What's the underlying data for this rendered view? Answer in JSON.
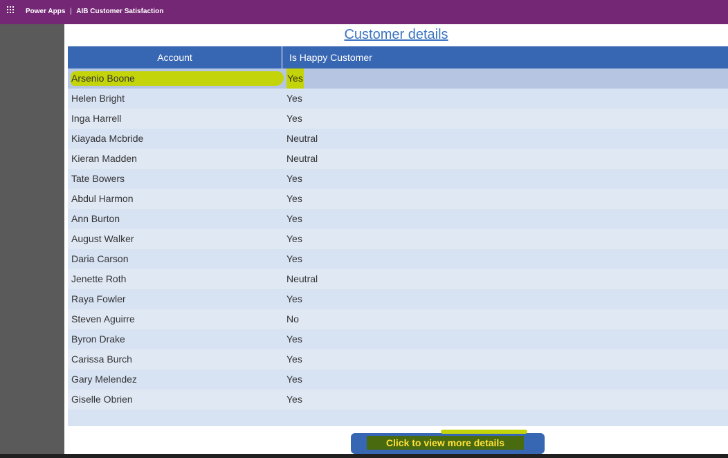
{
  "topbar": {
    "waffle_icon": "waffle-icon",
    "app_name": "Power Apps",
    "separator": "|",
    "app_title": "AIB Customer Satisfaction"
  },
  "page": {
    "title": "Customer details",
    "columns": [
      "Account",
      "Is Happy Customer"
    ]
  },
  "rows": [
    {
      "account": "Arsenio Boone",
      "happy": "Yes"
    },
    {
      "account": "Helen Bright",
      "happy": "Yes"
    },
    {
      "account": "Inga Harrell",
      "happy": "Yes"
    },
    {
      "account": "Kiayada Mcbride",
      "happy": "Neutral"
    },
    {
      "account": "Kieran Madden",
      "happy": "Neutral"
    },
    {
      "account": "Tate Bowers",
      "happy": "Yes"
    },
    {
      "account": "Abdul Harmon",
      "happy": "Yes"
    },
    {
      "account": "Ann Burton",
      "happy": "Yes"
    },
    {
      "account": "August Walker",
      "happy": "Yes"
    },
    {
      "account": "Daria Carson",
      "happy": "Yes"
    },
    {
      "account": "Jenette Roth",
      "happy": "Neutral"
    },
    {
      "account": "Raya Fowler",
      "happy": "Yes"
    },
    {
      "account": "Steven Aguirre",
      "happy": "No"
    },
    {
      "account": "Byron Drake",
      "happy": "Yes"
    },
    {
      "account": "Carissa Burch",
      "happy": "Yes"
    },
    {
      "account": "Gary Melendez",
      "happy": "Yes"
    },
    {
      "account": "Giselle Obrien",
      "happy": "Yes"
    }
  ],
  "footer": {
    "button_label": "Click to view more details"
  },
  "colors": {
    "topbar": "#742774",
    "header": "#3766b3",
    "grid_bg": "#d7e2f3",
    "highlight": "#c4d40a"
  }
}
